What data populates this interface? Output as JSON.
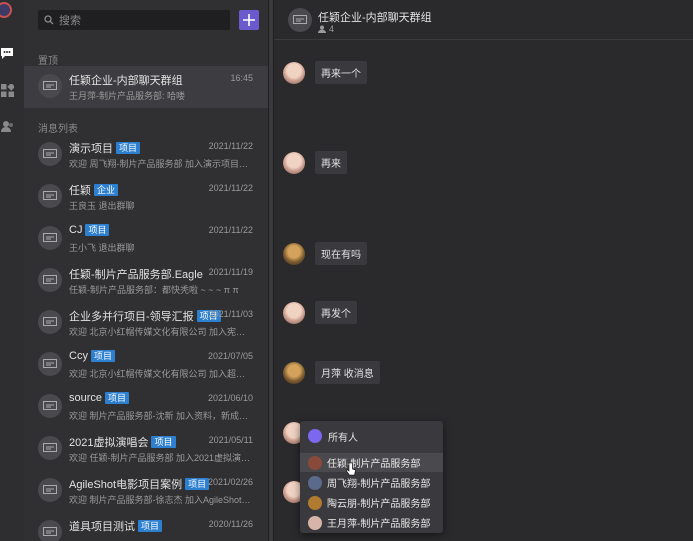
{
  "colors": {
    "accent": "#6a5acd",
    "tag": "#2d7fd0",
    "sidebar": "#303033",
    "active_item": "#3d3d41"
  },
  "rail": {
    "icons": [
      "app-logo-icon",
      "chat-icon",
      "apps-icon",
      "contacts-icon"
    ]
  },
  "search": {
    "placeholder": "搜索"
  },
  "sections": {
    "pinned": "置顶",
    "messages": "消息列表"
  },
  "pinned": [
    {
      "title": "任颖企业-内部聊天群组",
      "tag": "",
      "date": "16:45",
      "preview": "王月萍-制片产品服务部: 哈喽"
    }
  ],
  "conversations": [
    {
      "title": "演示项目",
      "tag": "项目",
      "date": "2021/11/22",
      "preview": "欢迎 周飞翔-制片产品服务部 加入演示项目，新成员..."
    },
    {
      "title": "任颖",
      "tag": "企业",
      "date": "2021/11/22",
      "preview": "王良玉 退出群聊"
    },
    {
      "title": "CJ",
      "tag": "项目",
      "date": "2021/11/22",
      "preview": "王小飞 退出群聊"
    },
    {
      "title": "任颖-制片产品服务部.Eagle",
      "tag": "",
      "date": "2021/11/19",
      "preview": "任颖-制片产品服务部：都快秃啦 ~ ~ ~ π π"
    },
    {
      "title": "企业多并行项目-领导汇报",
      "tag": "项目",
      "date": "2021/11/03",
      "preview": "欢迎 北京小红帽传媒文化有限公司 加入宪顺多并行项..."
    },
    {
      "title": "Ccy",
      "tag": "项目",
      "date": "2021/07/05",
      "preview": "欢迎 北京小红帽传媒文化有限公司 加入超越，新成员..."
    },
    {
      "title": "source",
      "tag": "项目",
      "date": "2021/06/10",
      "preview": "欢迎 制片产品服务部-沈新 加入资料，新成员入群可..."
    },
    {
      "title": "2021虚拟演唱会",
      "tag": "项目",
      "date": "2021/05/11",
      "preview": "欢迎 任颖-制片产品服务部 加入2021虚拟演唱会，新..."
    },
    {
      "title": "AgileShot电影项目案例",
      "tag": "项目",
      "date": "2021/02/26",
      "preview": "欢迎 制片产品服务部-徐志杰 加入AgileShot电影项目..."
    },
    {
      "title": "道具项目测试",
      "tag": "项目",
      "date": "2020/11/26",
      "preview": ""
    }
  ],
  "chat": {
    "title": "任颖企业-内部聊天群组",
    "member_count": "4",
    "messages": [
      {
        "avatar": "female",
        "text": "再来一个"
      },
      {
        "avatar": "female",
        "text": "再来"
      },
      {
        "avatar": "dark",
        "text": "现在有吗"
      },
      {
        "avatar": "female",
        "text": "再发个"
      },
      {
        "avatar": "dark",
        "text": "月萍  收消息"
      },
      {
        "avatar": "female",
        "text": ""
      },
      {
        "avatar": "female",
        "text": ""
      }
    ]
  },
  "mention_popup": {
    "header": "所有人",
    "members": [
      {
        "name": "任颖-制片产品服务部",
        "avatar": "#8a4a3a"
      },
      {
        "name": "周飞翔-制片产品服务部",
        "avatar": "#5a6a8a"
      },
      {
        "name": "陶云朋-制片产品服务部",
        "avatar": "#b07a30"
      },
      {
        "name": "王月萍-制片产品服务部",
        "avatar": "#d8b4a8"
      }
    ]
  }
}
